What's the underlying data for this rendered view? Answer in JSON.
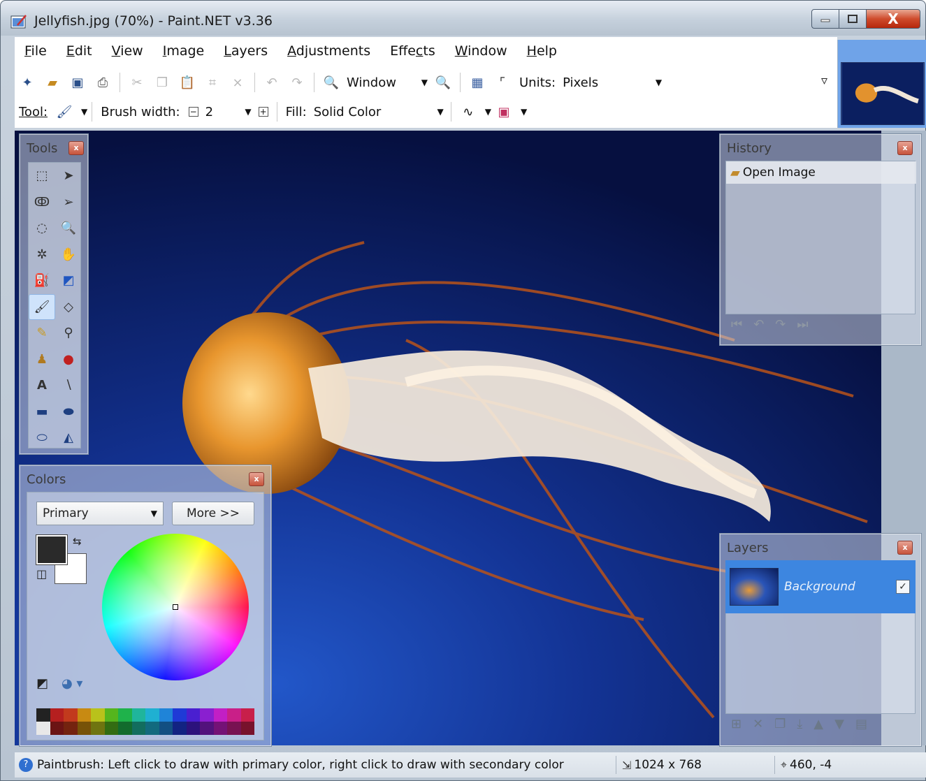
{
  "window": {
    "title": "Jellyfish.jpg (70%) - Paint.NET v3.36",
    "close_glyph": "X"
  },
  "menu": [
    {
      "label": "File",
      "access_key": "F"
    },
    {
      "label": "Edit",
      "access_key": "E"
    },
    {
      "label": "View",
      "access_key": "V"
    },
    {
      "label": "Image",
      "access_key": "I"
    },
    {
      "label": "Layers",
      "access_key": "L"
    },
    {
      "label": "Adjustments",
      "access_key": "A"
    },
    {
      "label": "Effects",
      "access_key": "c"
    },
    {
      "label": "Window",
      "access_key": "W"
    },
    {
      "label": "Help",
      "access_key": "H"
    }
  ],
  "toolbar": {
    "zoom_value": "Window",
    "units_label": "Units:",
    "units_value": "Pixels",
    "tool_label": "Tool:",
    "brush_width_label": "Brush width:",
    "brush_width_value": "2",
    "fill_label": "Fill:",
    "fill_value": "Solid Color"
  },
  "panels": {
    "tools": {
      "title": "Tools",
      "close": "x"
    },
    "colors": {
      "title": "Colors",
      "close": "x",
      "select_value": "Primary",
      "more_label": "More >>",
      "primary_color": "#2a2a2a",
      "secondary_color": "#ffffff",
      "palette_top": [
        "#222222",
        "#b51f1f",
        "#c23a1d",
        "#c88a12",
        "#b9c21b",
        "#55b51d",
        "#1fb24b",
        "#1fb59c",
        "#1fb0d2",
        "#1f84d8",
        "#1f3ad6",
        "#4a1fd0",
        "#8a1fd0",
        "#c21fc5",
        "#c91f88",
        "#c81f4a"
      ],
      "palette_bottom": [
        "#e8e8e8",
        "#6b1414",
        "#74230f",
        "#775208",
        "#6f7410",
        "#336c12",
        "#126b2d",
        "#126d5e",
        "#126a7e",
        "#124f82",
        "#122382",
        "#2c127c",
        "#52127c",
        "#741276",
        "#781252",
        "#78122c"
      ]
    },
    "history": {
      "title": "History",
      "close": "x",
      "items": [
        "Open Image"
      ]
    },
    "layers": {
      "title": "Layers",
      "close": "x",
      "items": [
        {
          "name": "Background",
          "visible": true
        }
      ]
    }
  },
  "status": {
    "message": "Paintbrush: Left click to draw with primary color, right click to draw with secondary color",
    "image_size": "1024 x 768",
    "cursor_position": "460, -4"
  },
  "colors": {
    "accent": "#3d86e0",
    "canvas_bg": "#0a1c58"
  }
}
